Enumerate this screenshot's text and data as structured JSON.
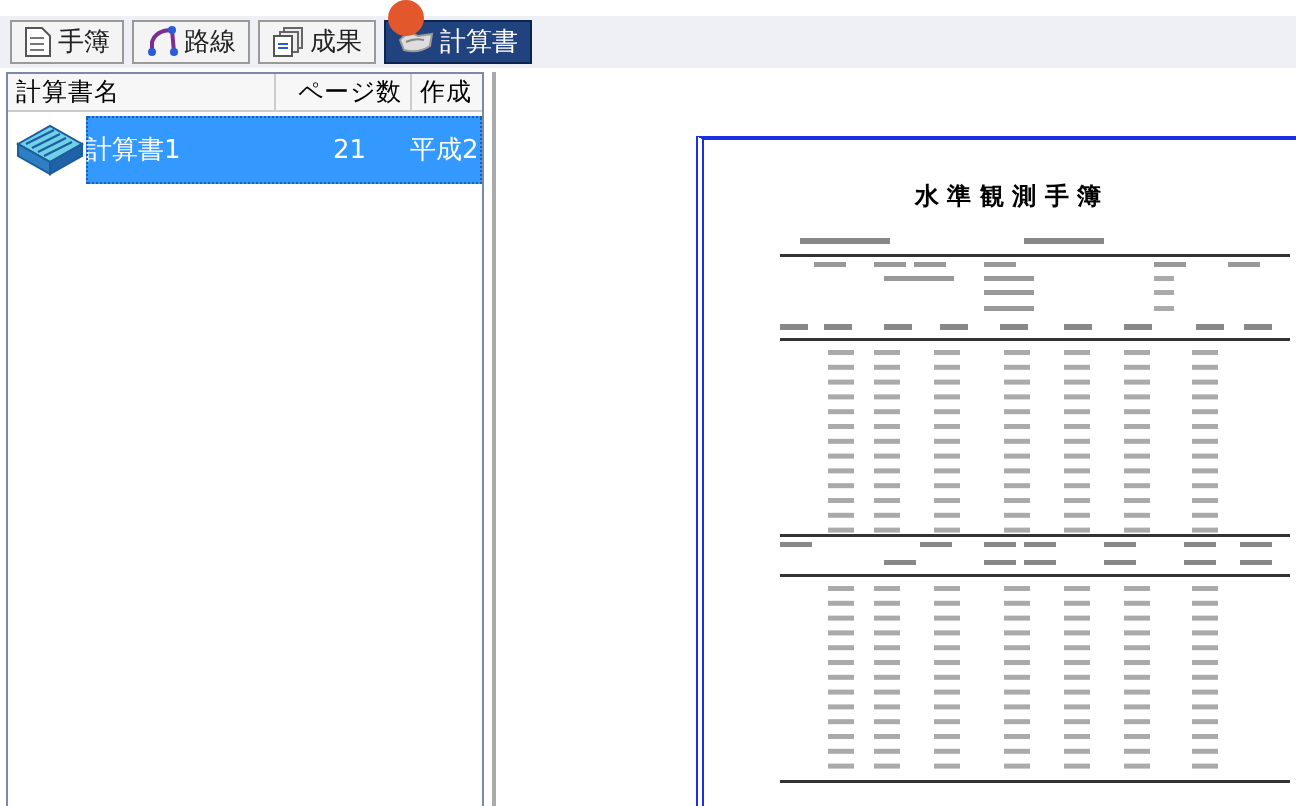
{
  "toolbar": {
    "tabs": [
      {
        "label": "手簿",
        "kind": "sheet",
        "selected": false
      },
      {
        "label": "路線",
        "kind": "route",
        "selected": false
      },
      {
        "label": "成果",
        "kind": "stack",
        "selected": false
      },
      {
        "label": "計算書",
        "kind": "calc",
        "selected": true
      }
    ]
  },
  "list": {
    "columns": [
      "計算書名",
      "ページ数",
      "作成"
    ],
    "rows": [
      {
        "name": "計算書1",
        "pages": "21",
        "date": "平成2",
        "selected": true
      }
    ]
  },
  "preview": {
    "title": "水 準 観 測 手 簿"
  }
}
